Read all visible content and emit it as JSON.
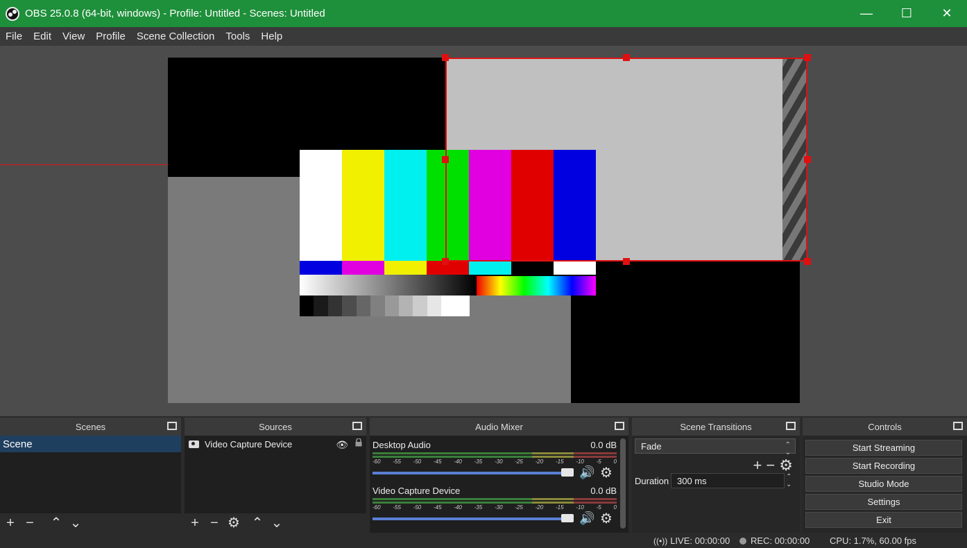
{
  "window": {
    "title": "OBS 25.0.8 (64-bit, windows) - Profile: Untitled - Scenes: Untitled",
    "minimize_label": "—",
    "maximize_label": "☐",
    "close_label": "✕",
    "titlebar_color": "#1e8f3a"
  },
  "menu": [
    "File",
    "Edit",
    "View",
    "Profile",
    "Scene Collection",
    "Tools",
    "Help"
  ],
  "preview": {
    "selection_color": "#e01010",
    "color_bars": [
      "#ffffff",
      "#f0f000",
      "#00f0f0",
      "#00e000",
      "#e000e0",
      "#e00000",
      "#0000e0"
    ],
    "color_bars_row2": [
      "#0000e0",
      "#e000e0",
      "#f0f000",
      "#e00000",
      "#00f0f0",
      "#000000",
      "#ffffff"
    ],
    "gray_steps": [
      "#000000",
      "#1a1a1a",
      "#333333",
      "#4d4d4d",
      "#666666",
      "#808080",
      "#999999",
      "#b3b3b3",
      "#cccccc",
      "#e6e6e6",
      "#ffffff",
      "#ffffff"
    ]
  },
  "docks": {
    "scenes": {
      "title": "Scenes",
      "items": [
        "Scene"
      ],
      "selected_color": "#1f3f5f"
    },
    "sources": {
      "title": "Sources",
      "items": [
        {
          "name": "Video Capture Device",
          "icon": "camera-icon",
          "visible": true,
          "locked": false
        }
      ]
    },
    "mixer": {
      "title": "Audio Mixer",
      "channels": [
        {
          "name": "Desktop Audio",
          "db": "0.0 dB"
        },
        {
          "name": "Video Capture Device",
          "db": "0.0 dB"
        }
      ],
      "scale": [
        "-60",
        "-55",
        "-50",
        "-45",
        "-40",
        "-35",
        "-30",
        "-25",
        "-20",
        "-15",
        "-10",
        "-5",
        "0"
      ]
    },
    "transitions": {
      "title": "Scene Transitions",
      "selected": "Fade",
      "duration_label": "Duration",
      "duration_value": "300 ms"
    },
    "controls": {
      "title": "Controls",
      "buttons": [
        "Start Streaming",
        "Start Recording",
        "Studio Mode",
        "Settings",
        "Exit"
      ]
    }
  },
  "status": {
    "live": "LIVE: 00:00:00",
    "rec": "REC: 00:00:00",
    "cpu": "CPU: 1.7%, 60.00 fps"
  }
}
